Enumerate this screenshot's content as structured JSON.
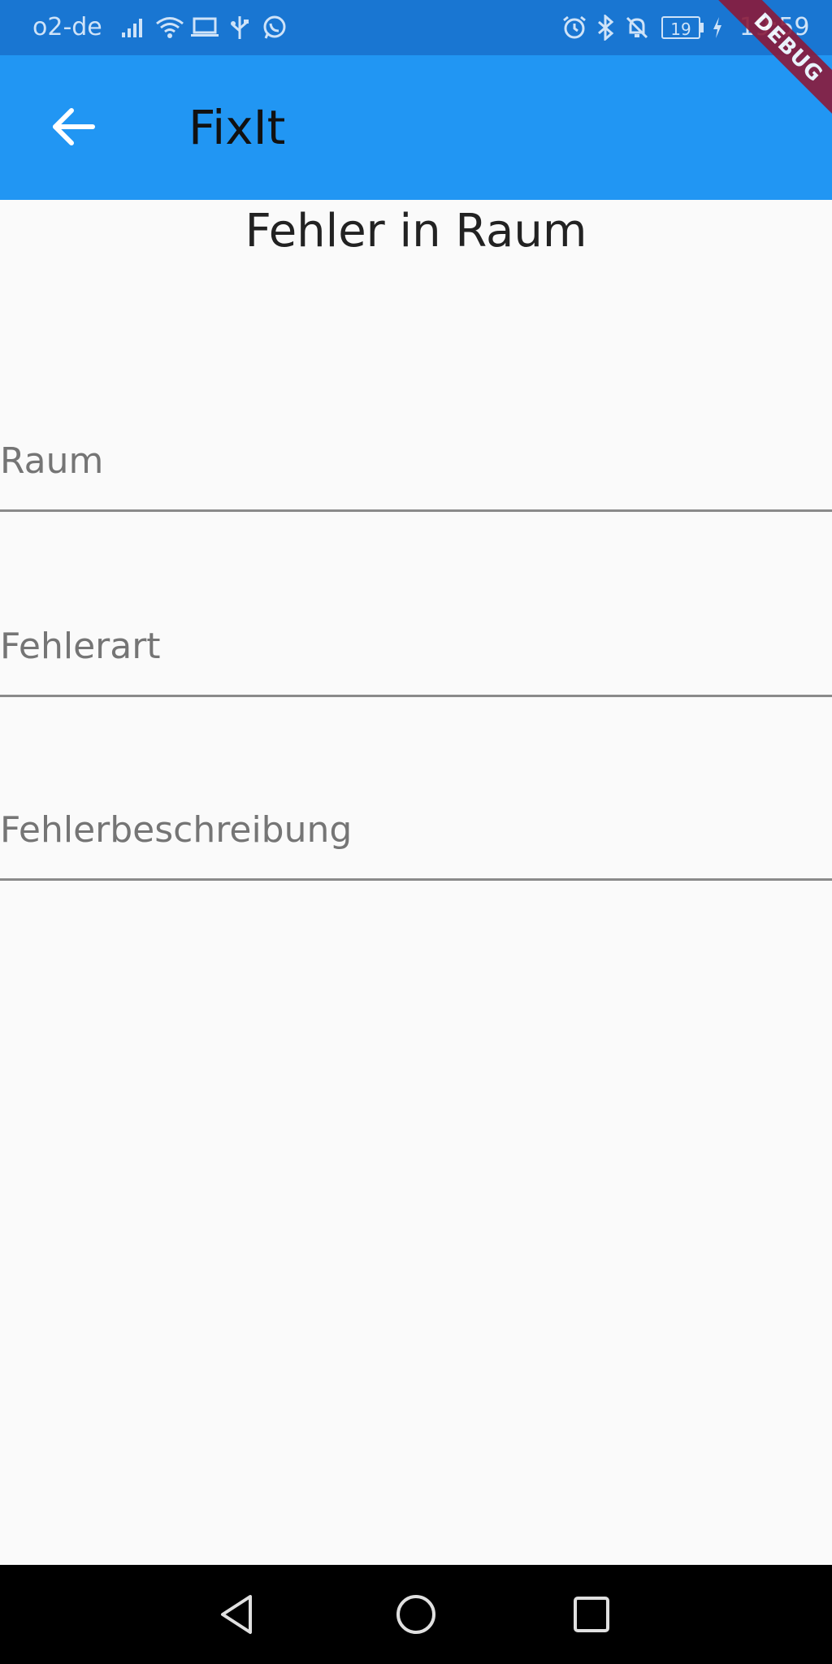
{
  "status_bar": {
    "carrier": "o2-de",
    "time": "19:59",
    "battery": "19",
    "icons": [
      "signal-icon",
      "wifi-icon",
      "laptop-icon",
      "usb-icon",
      "whatsapp-icon",
      "alarm-icon",
      "bluetooth-icon",
      "bell-off-icon",
      "battery-icon",
      "charging-icon"
    ]
  },
  "app_bar": {
    "title": "FixIt",
    "back_icon": "arrow-back-icon",
    "color": "#2196f3"
  },
  "debug_banner": "DEBUG",
  "page": {
    "heading": "Fehler in Raum",
    "fields": [
      {
        "label": "Raum"
      },
      {
        "label": "Fehlerart"
      },
      {
        "label": "Fehlerbeschreibung"
      }
    ]
  },
  "nav_bar": {
    "icons": [
      "back-triangle-icon",
      "home-circle-icon",
      "recents-square-icon"
    ]
  }
}
